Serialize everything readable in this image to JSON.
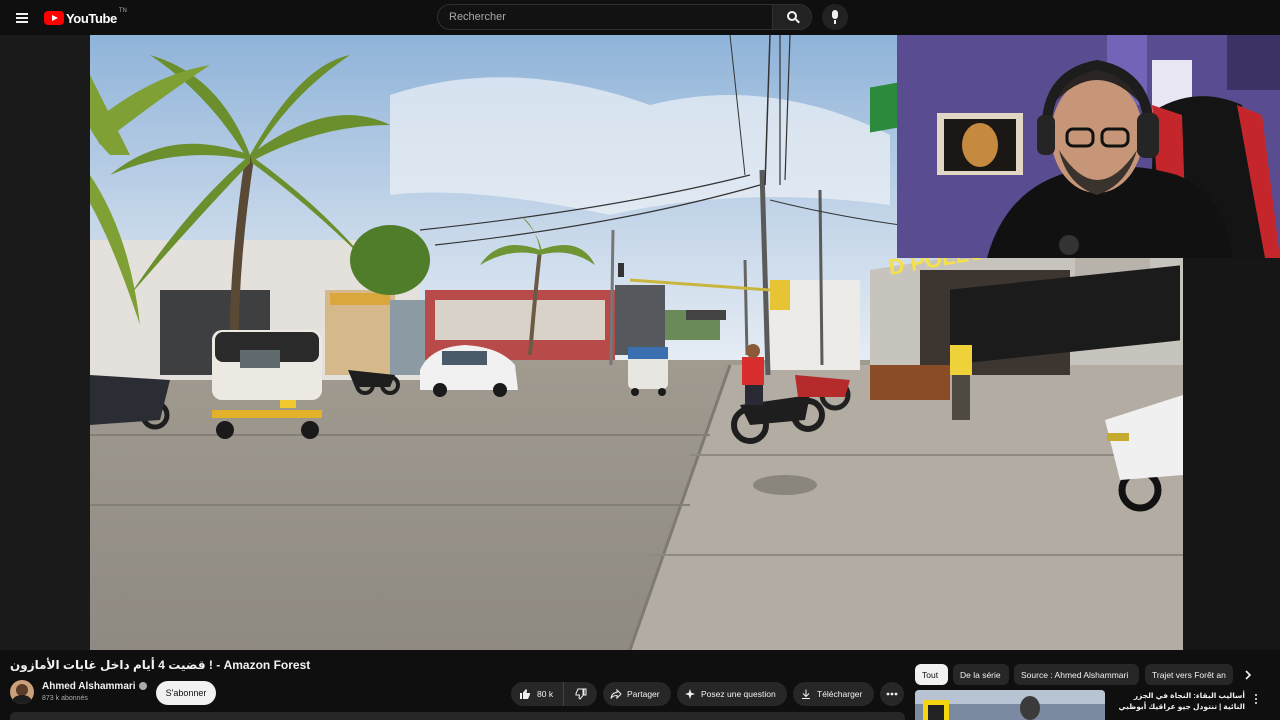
{
  "header": {
    "logo_text": "YouTube",
    "logo_country": "TN",
    "search_placeholder": "Rechercher"
  },
  "video": {
    "title": "قضيت 4 أيام داخل غابات الأمازون ! - Amazon Forest"
  },
  "channel": {
    "name": "Ahmed Alshammari",
    "subscribers": "873 k abonnés",
    "subscribe_label": "S'abonner"
  },
  "actions": {
    "like_count": "80 k",
    "share_label": "Partager",
    "ask_label": "Posez une question",
    "download_label": "Télécharger"
  },
  "chips": [
    "Tout",
    "De la série",
    "Source : Ahmed Alshammari",
    "Trajet vers Forêt an"
  ],
  "recommendation": {
    "title": "أساليب البقاء: النجاة في الجزر النائية | تنتودل جيو عراقيك أبوظبي"
  },
  "colors": {
    "background": "#0f0f0f",
    "pill": "#272727",
    "brand_red": "#ff0000",
    "text": "#f1f1f1",
    "muted": "#aaaaaa"
  }
}
